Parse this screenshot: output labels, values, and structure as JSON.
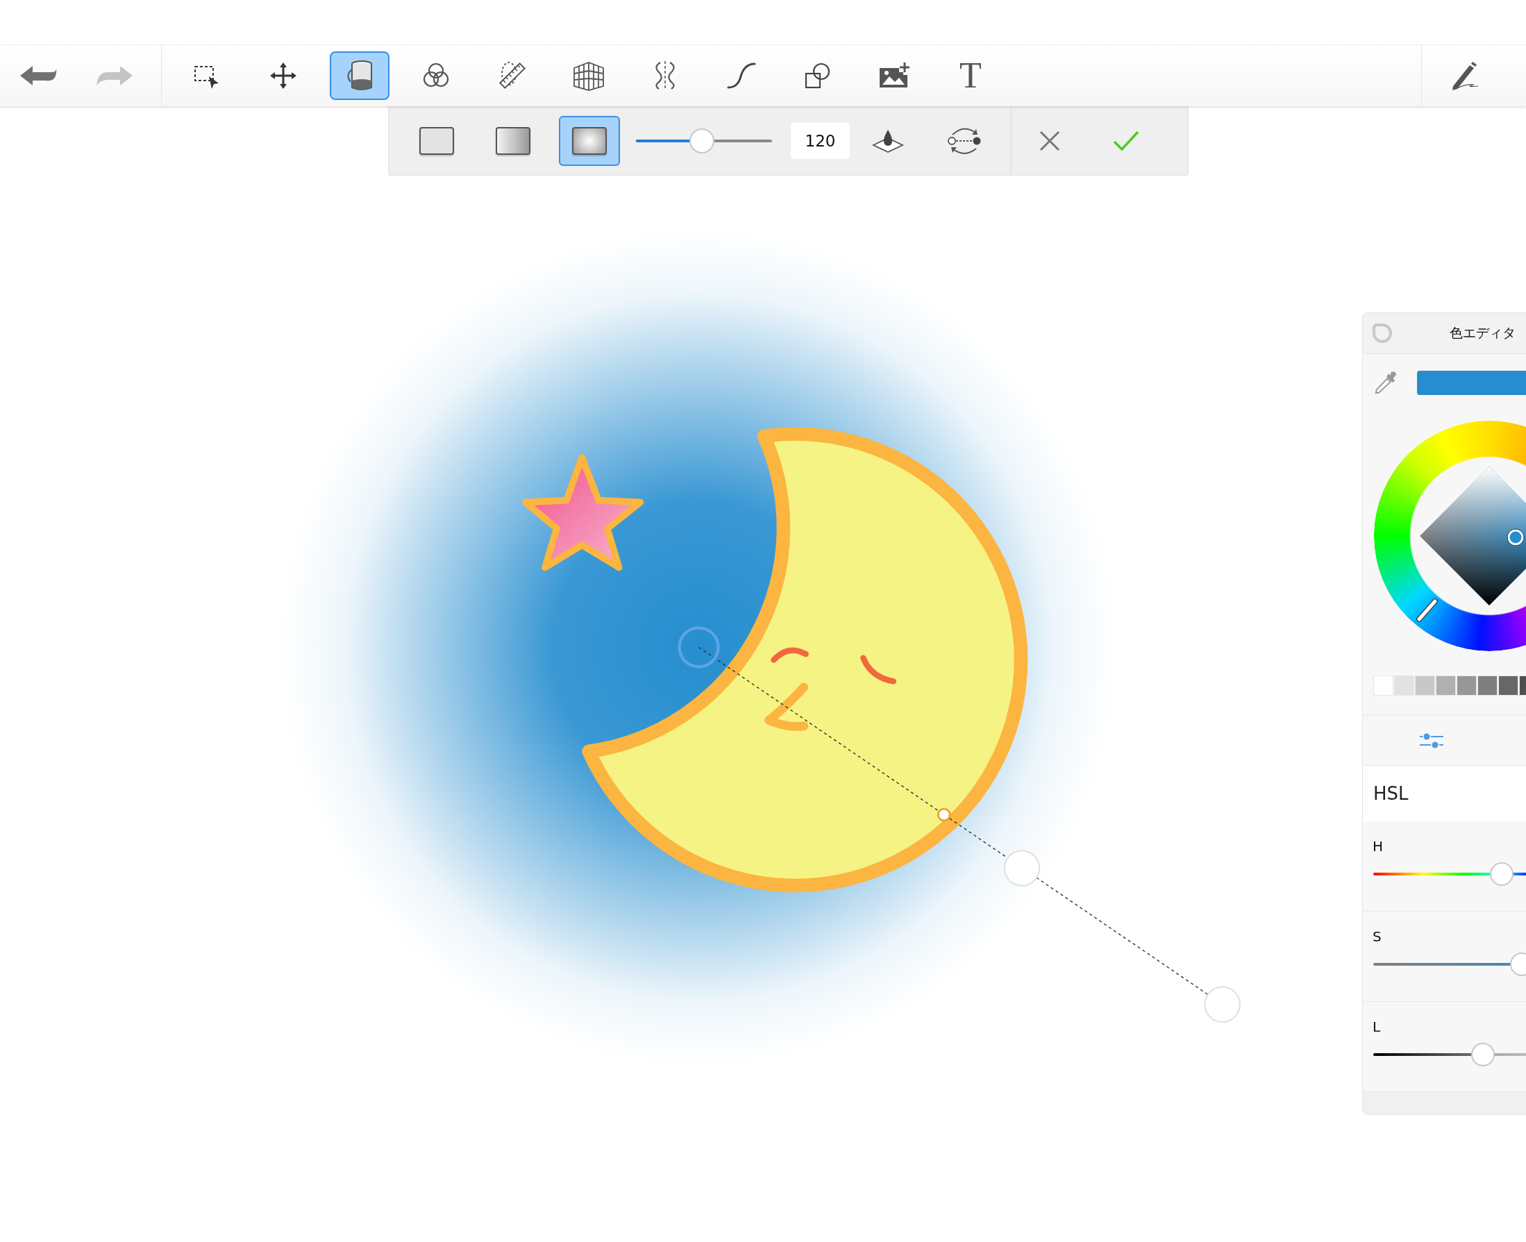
{
  "toolbar": {
    "history": [
      {
        "kind": "undo",
        "disabled": false
      },
      {
        "kind": "redo",
        "disabled": true
      }
    ],
    "tools": [
      {
        "kind": "select",
        "selected": false
      },
      {
        "kind": "move",
        "selected": false
      },
      {
        "kind": "fill",
        "selected": true
      },
      {
        "kind": "blend",
        "selected": false
      },
      {
        "kind": "ruler",
        "selected": false
      },
      {
        "kind": "perspective",
        "selected": false
      },
      {
        "kind": "symmetry",
        "selected": false
      },
      {
        "kind": "curve",
        "selected": false
      },
      {
        "kind": "shapes",
        "selected": false
      },
      {
        "kind": "image",
        "selected": false
      },
      {
        "kind": "text",
        "selected": false,
        "glyph": "T"
      }
    ]
  },
  "fill_bar": {
    "fill_types": [
      {
        "kind": "solid",
        "selected": false
      },
      {
        "kind": "linear",
        "selected": false
      },
      {
        "kind": "radial",
        "selected": true
      }
    ],
    "size_slider": {
      "level": 0.48
    },
    "size_value": "120"
  },
  "color_editor": {
    "title": "色エディタ",
    "mode": "HSL",
    "swatches": [
      {
        "color": "#ffffff"
      },
      {
        "color": "#e2e2e2"
      },
      {
        "color": "#c8c8c8"
      },
      {
        "color": "#b0b0b0"
      },
      {
        "color": "#979797"
      },
      {
        "color": "#7f7f7f"
      },
      {
        "color": "#676767"
      },
      {
        "color": "#4f4f4f"
      }
    ],
    "channels": [
      {
        "kind": "hue",
        "label": "H",
        "level": 0.56
      },
      {
        "kind": "saturation",
        "label": "S",
        "level": 0.65
      },
      {
        "kind": "lightness",
        "label": "L",
        "level": 0.48
      }
    ]
  }
}
